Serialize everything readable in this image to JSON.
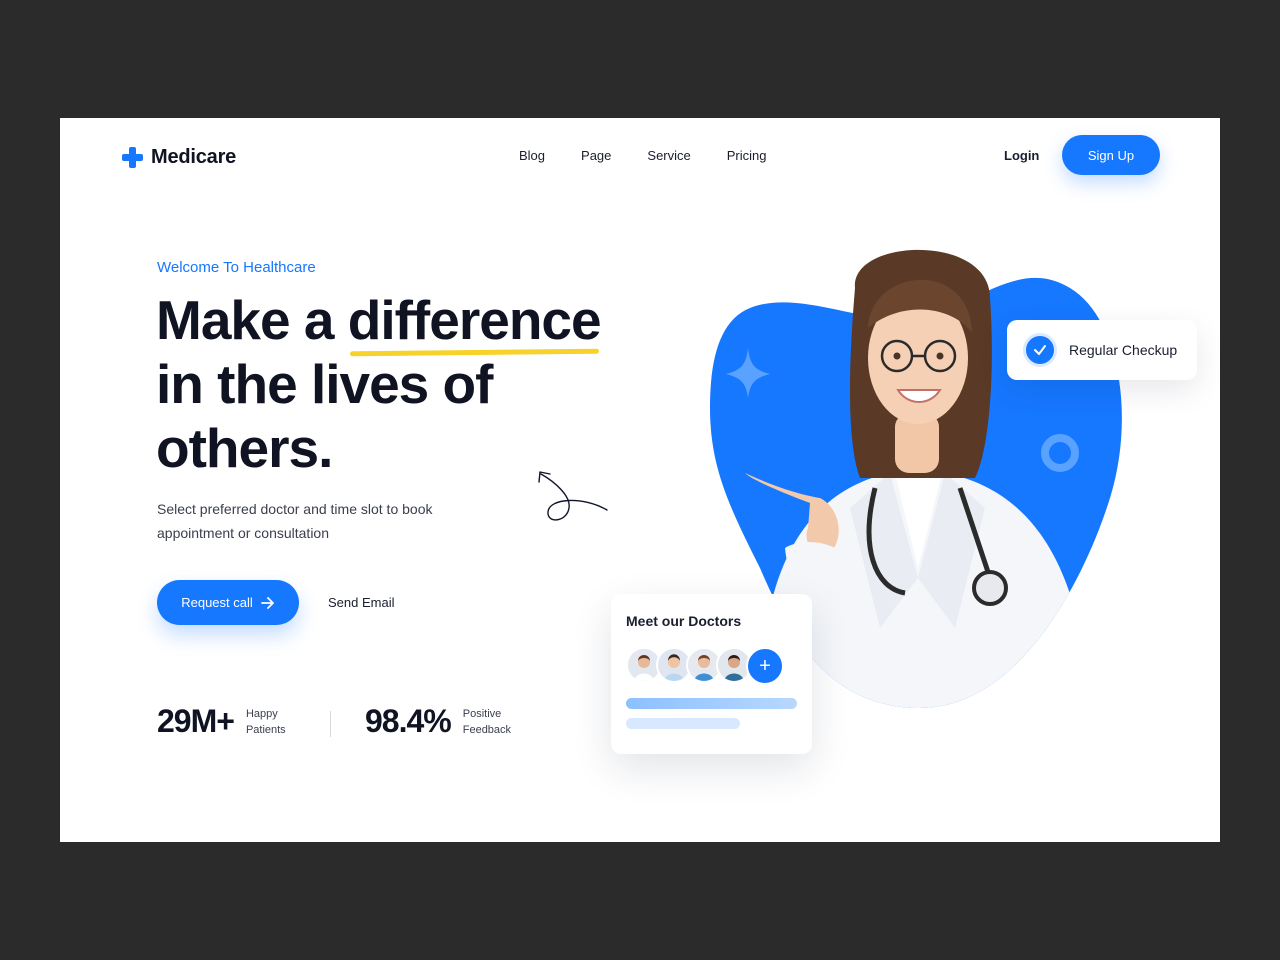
{
  "brand": {
    "name": "Medicare",
    "accent": "#1677ff",
    "highlight": "#f7d22b"
  },
  "nav": {
    "items": [
      "Blog",
      "Page",
      "Service",
      "Pricing"
    ]
  },
  "auth": {
    "login_label": "Login",
    "signup_label": "Sign Up"
  },
  "hero": {
    "eyebrow": "Welcome To Healthcare",
    "headline": {
      "line1_prefix": "Make a ",
      "line1_highlight": "difference",
      "line2": "in the lives of",
      "line3": "others."
    },
    "subtext": "Select preferred doctor and time slot to book appointment or consultation",
    "primary_cta": "Request call",
    "secondary_cta": "Send Email"
  },
  "stats": [
    {
      "value": "29M+",
      "label": "Happy Patients"
    },
    {
      "value": "98.4%",
      "label": "Positive Feedback"
    }
  ],
  "checkup_card": {
    "label": "Regular Checkup",
    "icon": "check-icon"
  },
  "doctors_card": {
    "title": "Meet our Doctors",
    "add_icon": "+"
  }
}
